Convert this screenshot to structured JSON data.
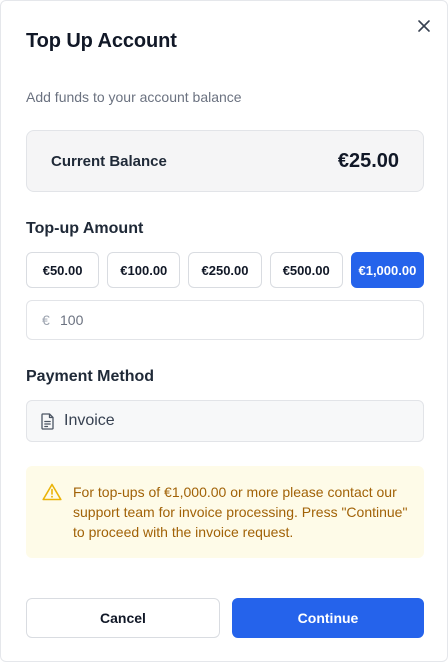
{
  "dialog": {
    "title": "Top Up Account",
    "subtitle": "Add funds to your account balance",
    "close_icon": "close-icon"
  },
  "balance": {
    "label": "Current Balance",
    "value": "€25.00"
  },
  "topup": {
    "label": "Top-up Amount",
    "options": [
      "€50.00",
      "€100.00",
      "€250.00",
      "€500.00",
      "€1,000.00"
    ],
    "selected_index": 4,
    "currency_symbol": "€",
    "input_value": "100"
  },
  "payment": {
    "label": "Payment Method",
    "method": "Invoice",
    "icon": "document-icon"
  },
  "notice": {
    "icon": "warning-icon",
    "text": "For top-ups of €1,000.00 or more please contact our support team for invoice processing. Press \"Continue\" to proceed with the invoice request."
  },
  "actions": {
    "cancel_label": "Cancel",
    "continue_label": "Continue"
  },
  "colors": {
    "accent": "#2563eb",
    "notice_bg": "#fefbe8",
    "notice_text": "#a16207",
    "warning_icon": "#eab308"
  }
}
